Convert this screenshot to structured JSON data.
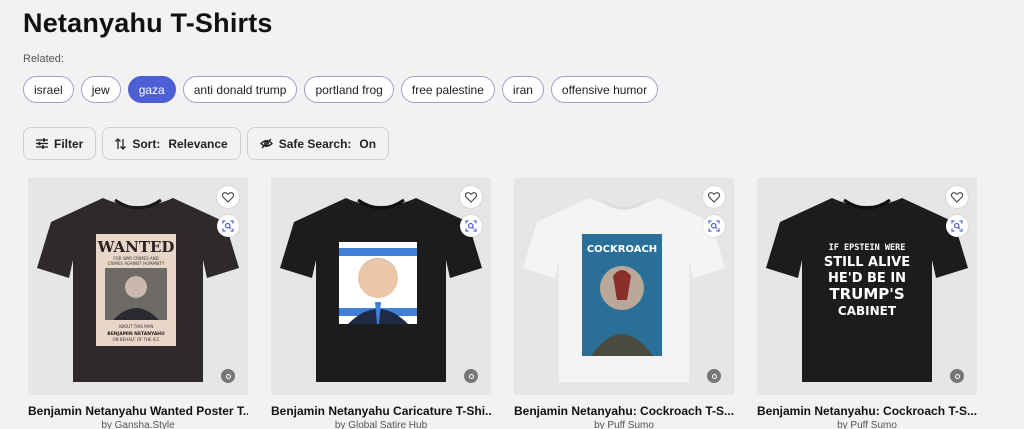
{
  "page": {
    "title": "Netanyahu T-Shirts"
  },
  "related": {
    "label": "Related:",
    "tags": [
      {
        "label": "israel",
        "active": false
      },
      {
        "label": "jew",
        "active": false
      },
      {
        "label": "gaza",
        "active": true
      },
      {
        "label": "anti donald trump",
        "active": false
      },
      {
        "label": "portland frog",
        "active": false
      },
      {
        "label": "free palestine",
        "active": false
      },
      {
        "label": "iran",
        "active": false
      },
      {
        "label": "offensive humor",
        "active": false
      }
    ]
  },
  "toolbar": {
    "filter_label": "Filter",
    "sort_label": "Sort:",
    "sort_value": "Relevance",
    "safe_label": "Safe Search:",
    "safe_value": "On"
  },
  "products": [
    {
      "title": "Benjamin Netanyahu Wanted Poster T...",
      "artist": "by Gansha.Style",
      "shirt_color": "#2d2a29",
      "art": "wanted",
      "art_text": [
        "WANTED",
        "FOR WAR CRIMES AND",
        "CRIMES AGAINST HUMANITY",
        "ABOUT THIS MAN",
        "BENJAMIN NETANYAHU",
        "ON BEHALF OF THE ICC"
      ]
    },
    {
      "title": "Benjamin Netanyahu Caricature T-Shi...",
      "artist": "by Global Satire Hub",
      "shirt_color": "#1c1c1c",
      "art": "caricature",
      "art_text": []
    },
    {
      "title": "Benjamin Netanyahu: Cockroach T-S...",
      "artist": "by Puff Sumo",
      "shirt_color": "#f4f4f4",
      "art": "cockroach",
      "art_text": [
        "COCKROACH"
      ]
    },
    {
      "title": "Benjamin Netanyahu: Cockroach T-S...",
      "artist": "by Puff Sumo",
      "shirt_color": "#1c1c1c",
      "art": "text",
      "art_text": [
        "IF EPSTEIN WERE",
        "STILL ALIVE",
        "HE'D BE IN",
        "TRUMP'S",
        "CABINET"
      ]
    }
  ],
  "icons": {
    "filter": "sliders-icon",
    "sort": "sort-arrows-icon",
    "safe": "eye-slash-icon",
    "favorite": "heart-icon",
    "zoom": "magnify-icon",
    "badge": "info-icon"
  }
}
